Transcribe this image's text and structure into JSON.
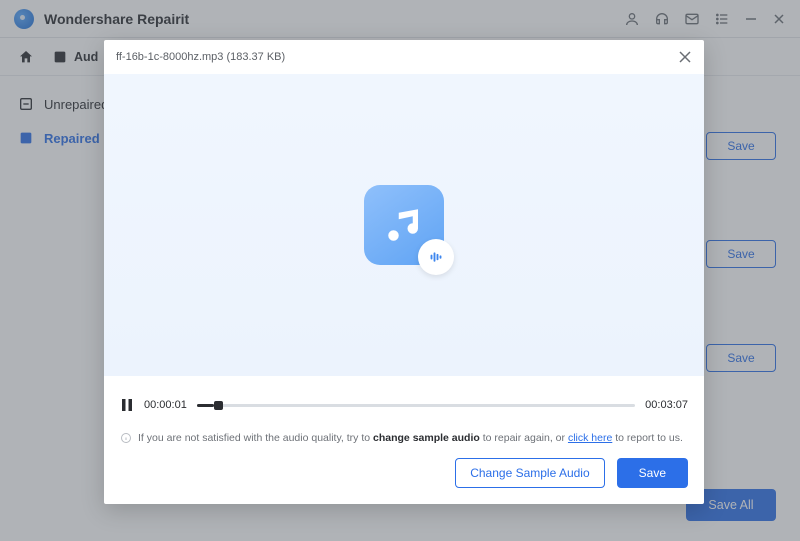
{
  "app": {
    "title": "Wondershare Repairit"
  },
  "tabs": {
    "audio": "Aud"
  },
  "sidebar": {
    "unrepaired": "Unrepaired",
    "repaired": "Repaired"
  },
  "list": {
    "save": "Save",
    "save_all": "Save All"
  },
  "modal": {
    "filename": "ff-16b-1c-8000hz.mp3 (183.37 KB)",
    "current_time": "00:00:01",
    "total_time": "00:03:07",
    "note_pre": "If you are not satisfied with the audio quality, try to ",
    "note_bold": "change sample audio",
    "note_mid": " to repair again, or ",
    "note_link": "click here",
    "note_post": " to report to us.",
    "change_sample": "Change Sample Audio",
    "save": "Save"
  }
}
